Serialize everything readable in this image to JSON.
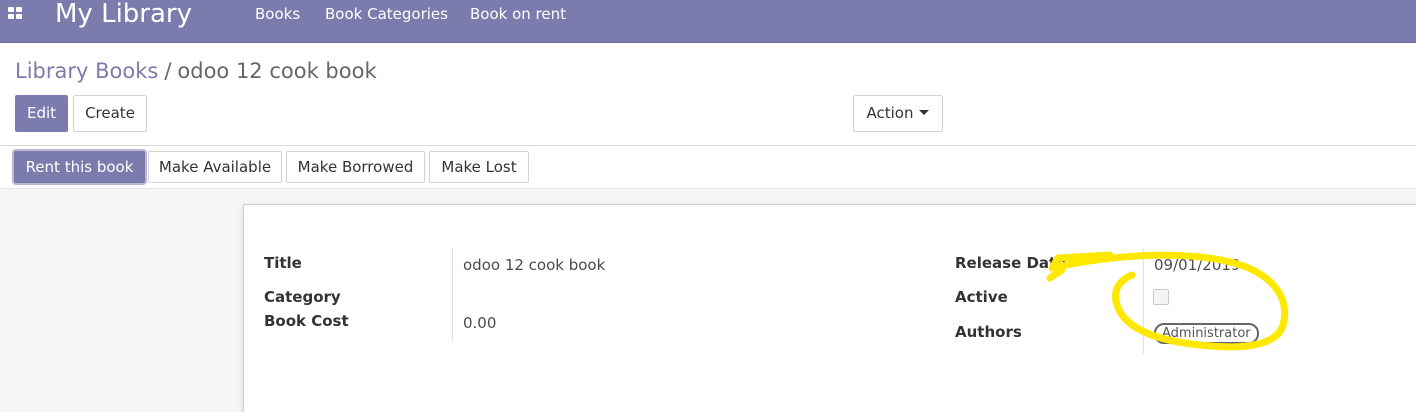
{
  "navbar": {
    "brand": "My Library",
    "menu": [
      "Books",
      "Book Categories",
      "Book on rent"
    ],
    "color": "#7c7bad"
  },
  "breadcrumb": {
    "parent": "Library Books",
    "separator": "/",
    "current": "odoo 12 cook book"
  },
  "toolbar": {
    "edit_label": "Edit",
    "create_label": "Create",
    "action_label": "Action"
  },
  "statusbar": {
    "buttons": [
      "Rent this book",
      "Make Available",
      "Make Borrowed",
      "Make Lost"
    ]
  },
  "form": {
    "left": {
      "title_label": "Title",
      "title_value": "odoo 12 cook book",
      "category_label": "Category",
      "category_value": "",
      "cost_label": "Book Cost",
      "cost_value": "0.00"
    },
    "right": {
      "release_label": "Release Date",
      "release_value": "09/01/2019",
      "active_label": "Active",
      "active_checked": false,
      "authors_label": "Authors",
      "authors_tags": [
        "Administrator"
      ]
    }
  },
  "annotation_color": "#ffe800"
}
